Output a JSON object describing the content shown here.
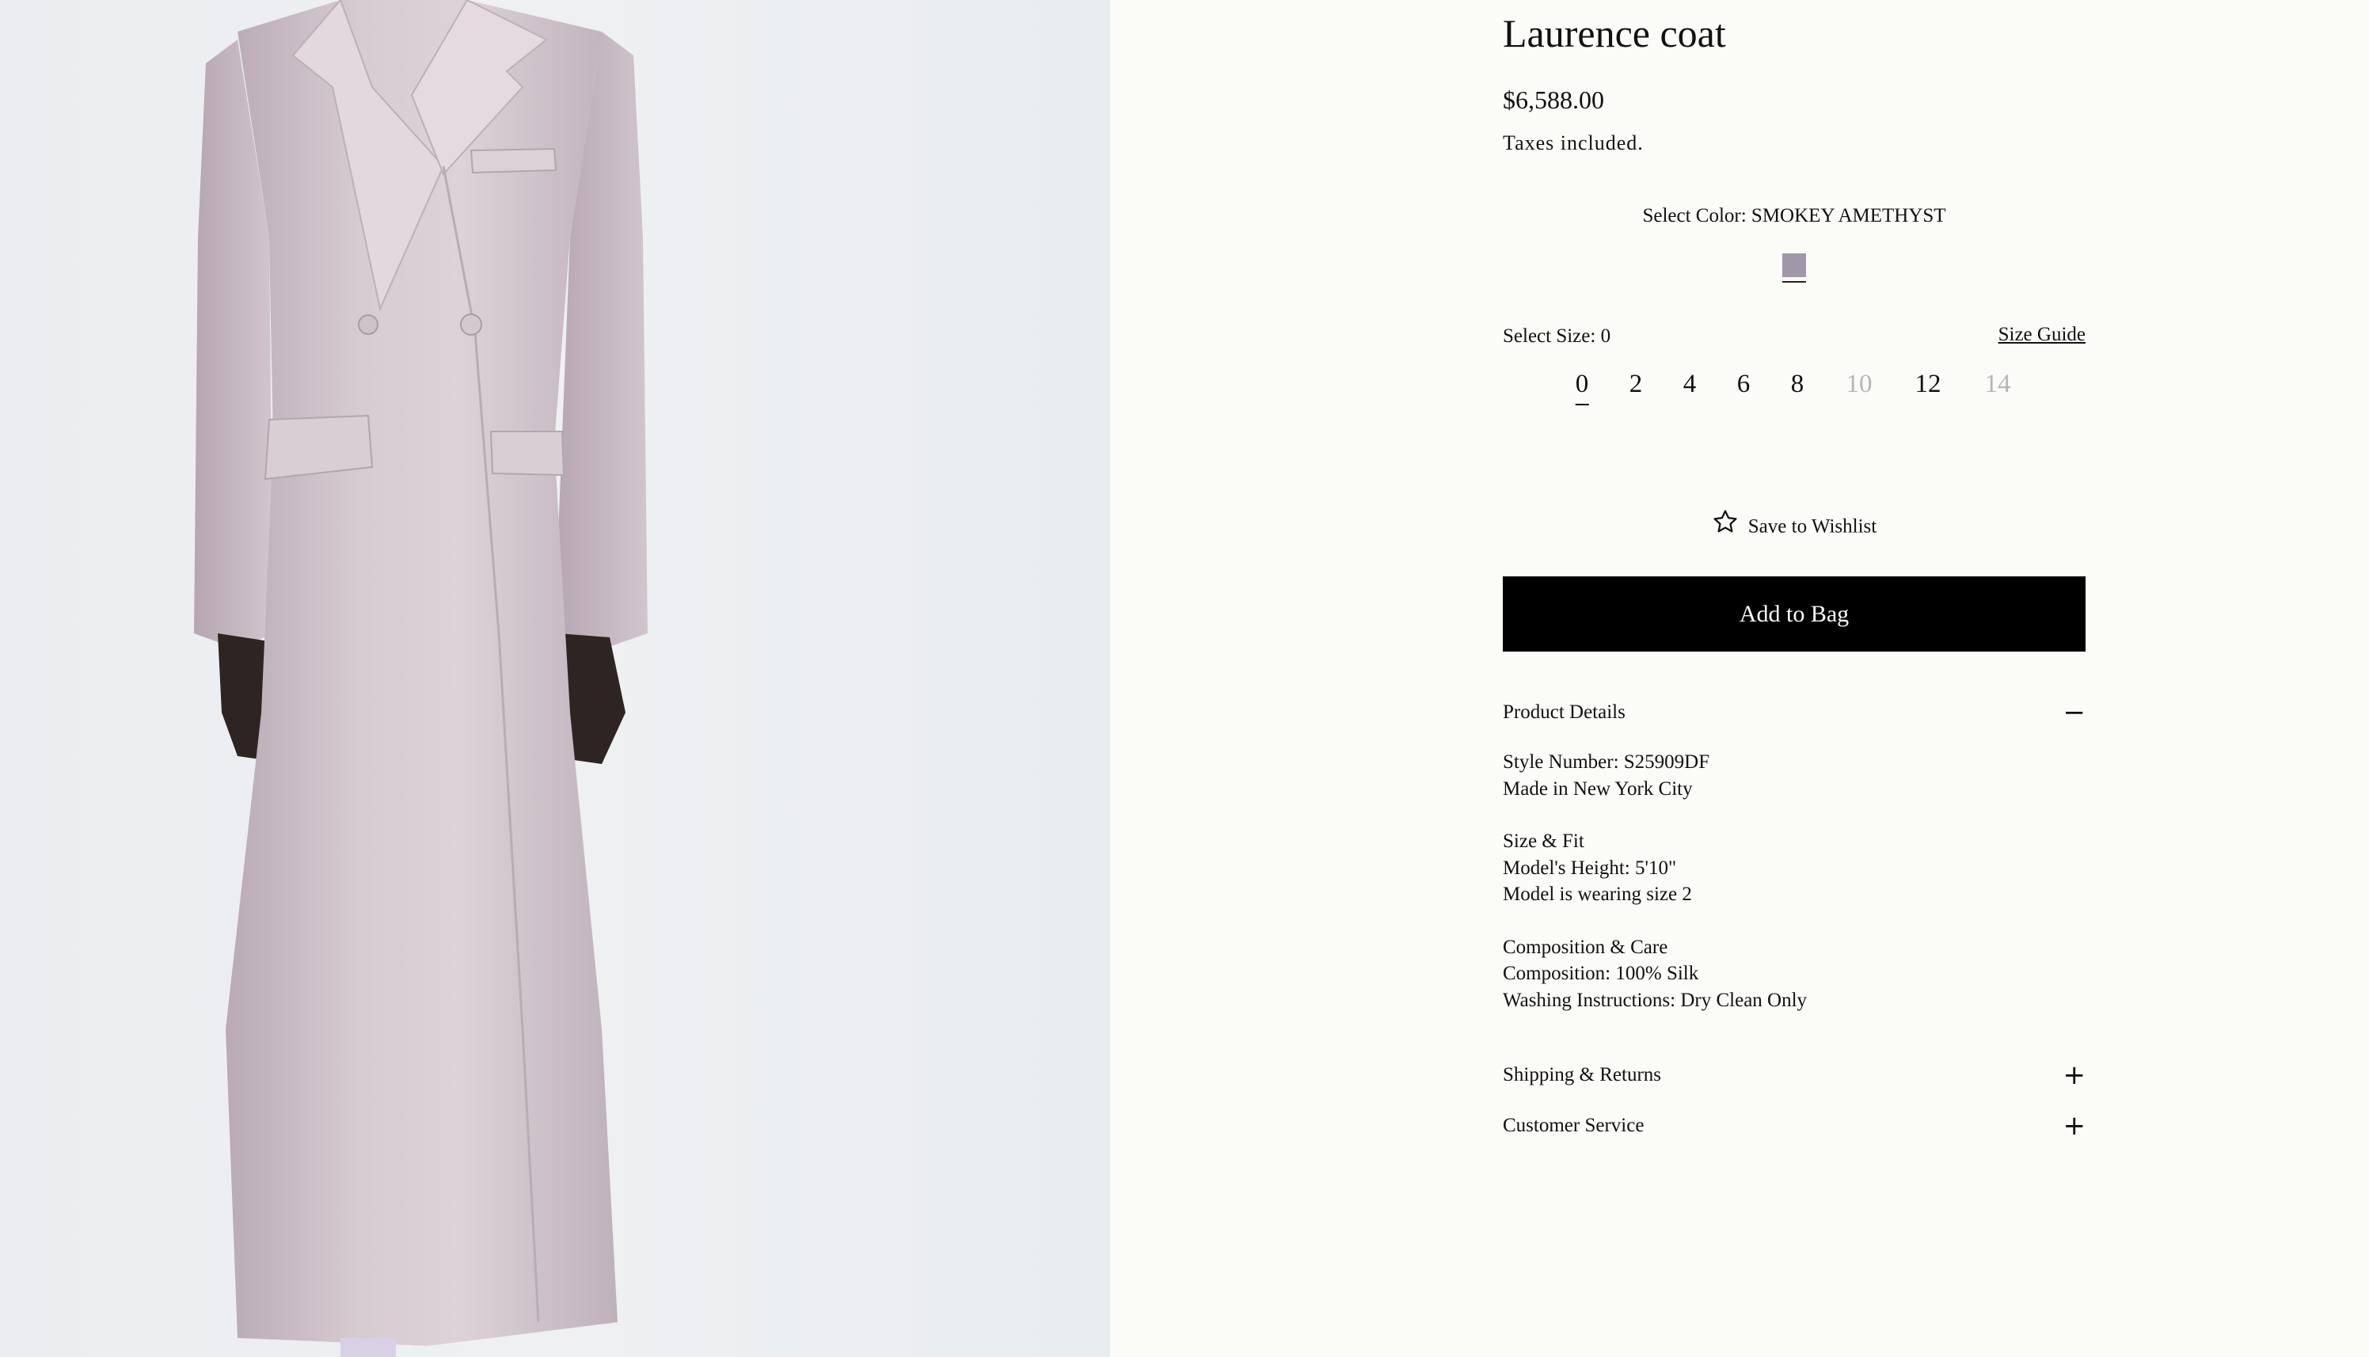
{
  "product": {
    "title": "Laurence coat",
    "price": "$6,588.00",
    "tax_note": "Taxes included.",
    "color_label": "Select Color: SMOKEY AMETHYST",
    "swatch_color": "#a197a9",
    "size_label": "Select Size: 0",
    "size_guide": "Size Guide",
    "sizes": [
      {
        "label": "0",
        "available": true,
        "selected": true
      },
      {
        "label": "2",
        "available": true
      },
      {
        "label": "4",
        "available": true
      },
      {
        "label": "6",
        "available": true
      },
      {
        "label": "8",
        "available": true
      },
      {
        "label": "10",
        "available": false
      },
      {
        "label": "12",
        "available": true
      },
      {
        "label": "14",
        "available": false
      }
    ],
    "wishlist": "Save to Wishlist",
    "add_to_bag": "Add to Bag"
  },
  "accordion": {
    "details": {
      "heading": "Product Details",
      "toggle": "−",
      "style_number": "Style Number: S25909DF",
      "made_in": "Made in New York City",
      "size_fit_heading": "Size & Fit",
      "model_height": "Model's Height: 5'10\"",
      "model_size": "Model is wearing size 2",
      "composition_heading": "Composition & Care",
      "composition": "Composition:  100% Silk",
      "washing": "Washing Instructions: Dry Clean Only"
    },
    "shipping": {
      "heading": "Shipping & Returns",
      "toggle": "+"
    },
    "service": {
      "heading": "Customer Service",
      "toggle": "+"
    }
  },
  "icons": {
    "wishlist": "star-outline-icon",
    "expanded": "minus-icon",
    "collapsed": "plus-icon"
  }
}
